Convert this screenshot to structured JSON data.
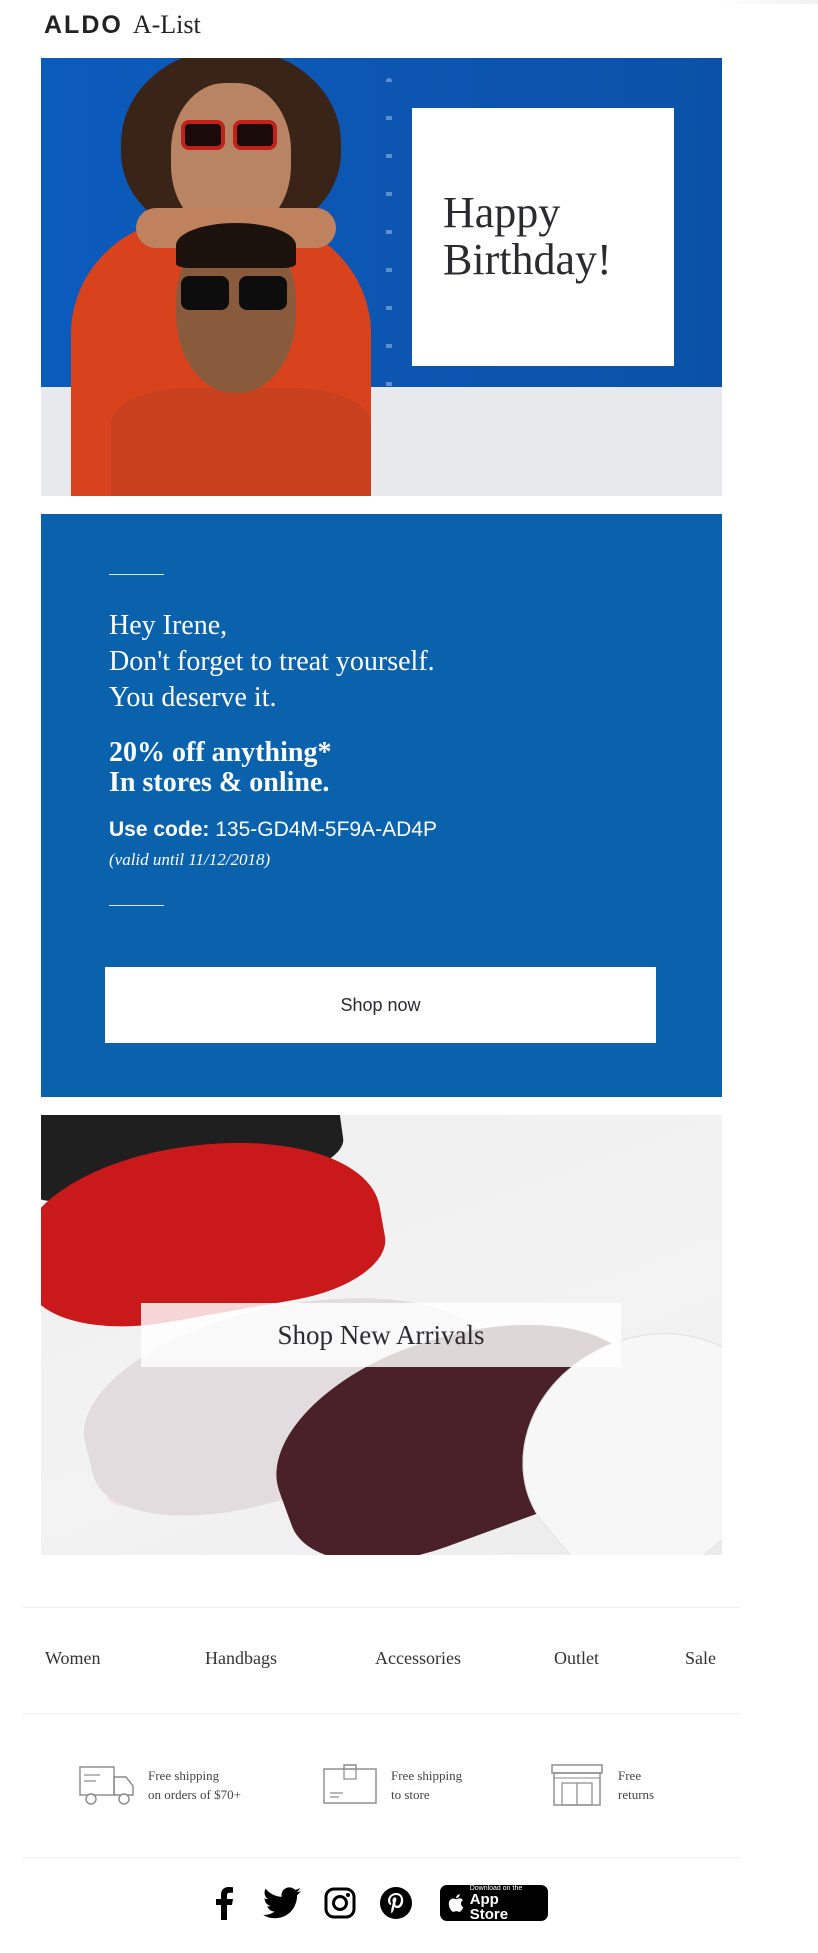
{
  "header": {
    "brand": "ALDO",
    "program": "A-List"
  },
  "hero": {
    "card_title": "Happy\nBirthday!"
  },
  "offer": {
    "greeting_lines": [
      "Hey Irene,",
      "Don't forget to treat yourself.",
      "You deserve it."
    ],
    "headline_lines": [
      "20% off anything*",
      "In stores & online."
    ],
    "code_label": "Use code:",
    "code_value": "135-GD4M-5F9A-AD4P",
    "valid_text": "(valid until 11/12/2018)",
    "button_label": "Shop now"
  },
  "arrivals": {
    "label": "Shop New Arrivals"
  },
  "nav": {
    "items": [
      {
        "label": "Women"
      },
      {
        "label": "Handbags"
      },
      {
        "label": "Accessories"
      },
      {
        "label": "Outlet"
      },
      {
        "label": "Sale"
      }
    ]
  },
  "perks": [
    {
      "icon": "delivery-truck-icon",
      "text": "Free shipping\non orders of $70+"
    },
    {
      "icon": "package-box-icon",
      "text": "Free shipping\nto store"
    },
    {
      "icon": "storefront-icon",
      "text": "Free\nreturns"
    }
  ],
  "social": {
    "icons": [
      "facebook-icon",
      "twitter-icon",
      "instagram-icon",
      "pinterest-icon"
    ],
    "appstore_small": "Download on the",
    "appstore_big": "App Store"
  },
  "colors": {
    "hero_blue": "#0a57b4",
    "offer_blue": "#0a62ac",
    "text_dark": "#2b2a2e"
  }
}
